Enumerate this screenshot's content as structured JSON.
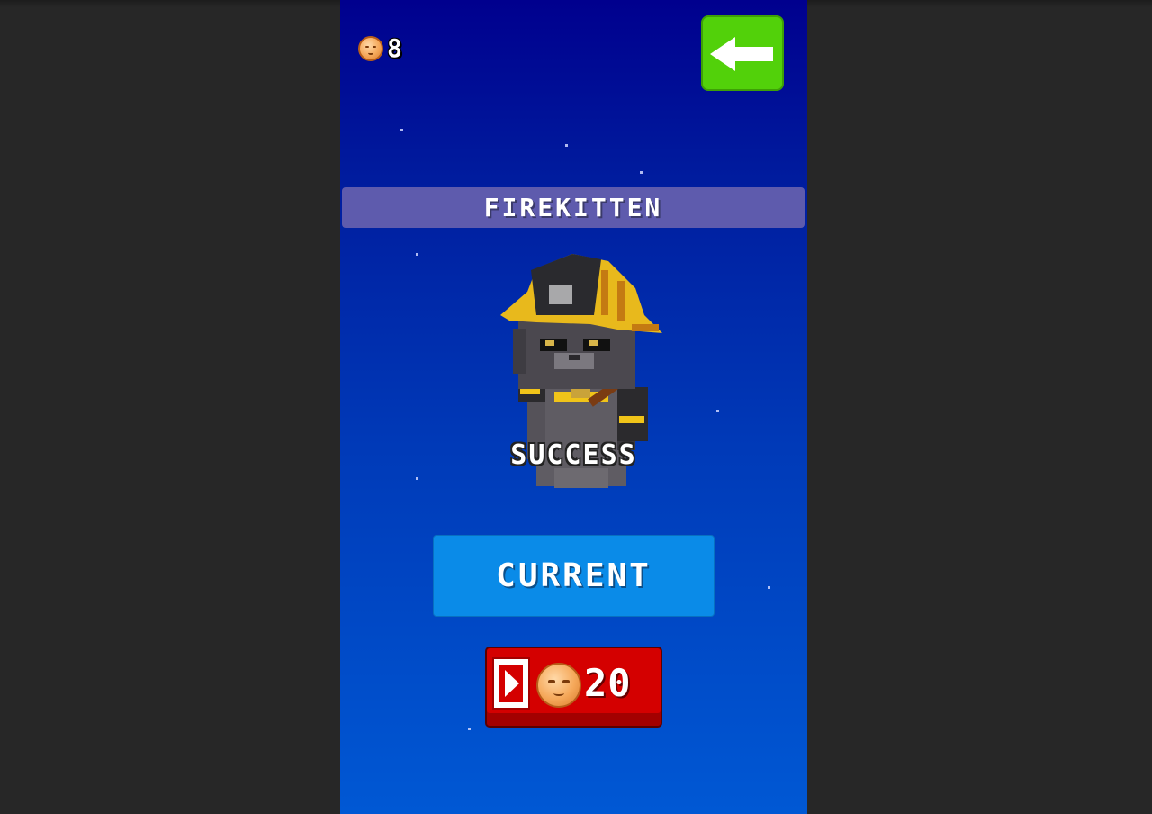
{
  "hud": {
    "coin_icon": "cat-coin-icon",
    "coin_count": "8",
    "back_icon": "arrow-left-icon",
    "back_color": "#52d10a"
  },
  "character": {
    "name": "FIREKITTEN",
    "sprite": "firefighter-cat-sprite",
    "status": "SUCCESS"
  },
  "actions": {
    "current_label": "CURRENT",
    "current_color": "#0a8be8",
    "reward_icon": "video-ad-icon",
    "reward_coin_icon": "cat-coin-icon",
    "reward_amount": "20",
    "reward_color": "#d40000"
  }
}
